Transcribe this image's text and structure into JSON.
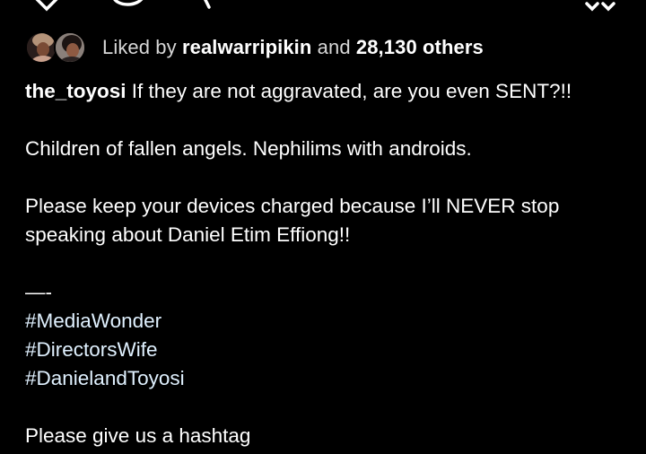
{
  "post": {
    "liked_by": {
      "prefix": "Liked by",
      "user": "realwarripikin",
      "conjunction": "and",
      "others": "28,130 others"
    },
    "caption": {
      "username": "the_toyosi",
      "line1": "If they are not aggravated, are you even SENT?!!",
      "line2": "Children of fallen angels. Nephilims with androids.",
      "line3": "Please keep your devices charged because I’ll NEVER stop",
      "line4": "speaking about Daniel Etim Effiong!!",
      "divider": "—-",
      "hashtags": [
        "#MediaWonder",
        "#DirectorsWife",
        "#DanielandToyosi"
      ],
      "line_last": "Please give us a hashtag"
    }
  }
}
